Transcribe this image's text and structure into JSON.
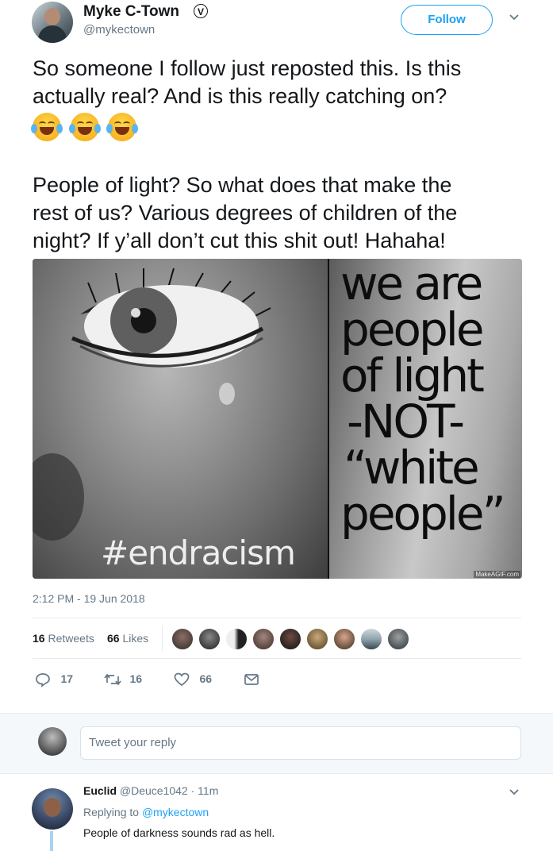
{
  "header": {
    "display_name": "Myke C-Town",
    "handle": "@mykectown",
    "follow_label": "Follow"
  },
  "tweet": {
    "line1": "So someone I follow just reposted this. Is this",
    "line2": "actually real? And is this really catching on?",
    "emojis": [
      "laughing-with-tears",
      "laughing-with-tears",
      "laughing-with-tears"
    ],
    "para2_line1": "People of light? So what does that make the",
    "para2_line2": "rest of us? Various degrees of children of the",
    "para2_line3": "night? If y’all don’t cut this shit out! Hahaha!",
    "timestamp": "2:12 PM - 19 Jun 2018"
  },
  "image": {
    "hashtag": "#endracism",
    "text_lines": [
      "we are",
      "people",
      "of light",
      "-NOT-",
      "“white",
      "people”"
    ],
    "watermark": "MakeAGIF.com"
  },
  "stats": {
    "retweets_count": "16",
    "retweets_label": "Retweets",
    "likes_count": "66",
    "likes_label": "Likes"
  },
  "actions": {
    "reply_count": "17",
    "retweet_count": "16",
    "like_count": "66"
  },
  "reply_box": {
    "placeholder": "Tweet your reply"
  },
  "reply": {
    "display_name": "Euclid",
    "handle": "@Deuce1042",
    "time": "· 11m",
    "replying_to_prefix": "Replying to",
    "replying_to_handle": "@mykectown",
    "text": "People of darkness sounds rad as hell."
  },
  "colors": {
    "accent": "#1da1f2",
    "muted": "#657786",
    "divider": "#e6ecf0"
  }
}
